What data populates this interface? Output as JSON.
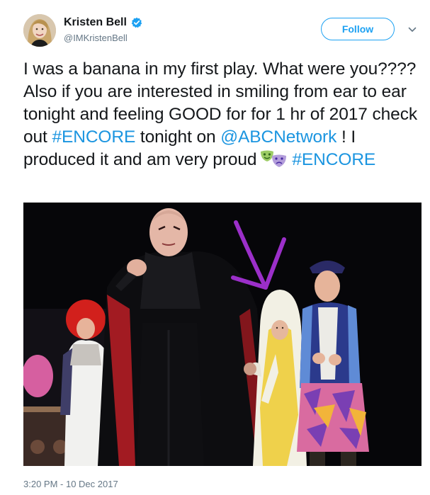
{
  "author": {
    "name": "Kristen Bell",
    "handle": "@IMKristenBell",
    "verified": true,
    "avatar_icon": "avatar-photo"
  },
  "follow_label": "Follow",
  "tweet": {
    "line_1": "I was a banana in my first play. What were you???? Also if you are interested in smiling from ear to ear tonight and feeling GOOD for for 1 hr of 2017 check out ",
    "hashtag_1": "#ENCORE",
    "line_2": " tonight on ",
    "mention": "@ABCNetwork",
    "line_3": " ! I produced it and am very proud",
    "emoji_icon": "performing-arts-icon",
    "hashtag_2": "#ENCORE"
  },
  "photo_icon": "stage-play-photo",
  "timestamp": "3:20 PM - 10 Dec 2017",
  "colors": {
    "link": "#1b95e0",
    "follow": "#1da1f2",
    "secondary_text": "#657786",
    "arrow_annotation": "#9b2fc9"
  }
}
